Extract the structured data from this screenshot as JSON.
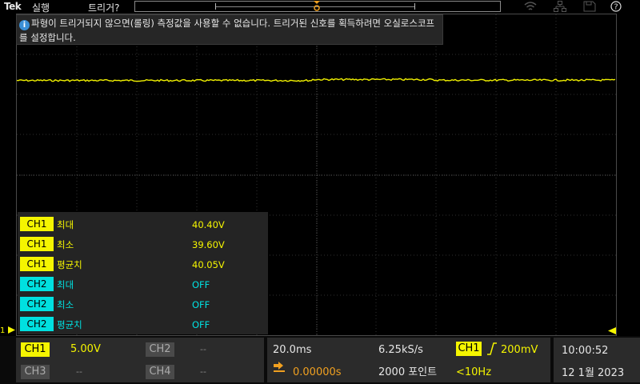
{
  "topbar": {
    "logo": "Tek",
    "run_state": "실행",
    "trigger_state": "트리거?",
    "icons": [
      "wifi-icon",
      "network-icon",
      "save-icon",
      "help-icon"
    ],
    "help_glyph": "?"
  },
  "message": {
    "icon": "info-icon",
    "icon_glyph": "i",
    "line1": "파형이 트리거되지 않으면(롤링) 측정값을 사용할 수 없습니다. 트리거된 신호를 획득하려면 오실로스코프",
    "line2": "를 설정합니다."
  },
  "measurements": [
    {
      "channel": "CH1",
      "name": "최대",
      "value": "40.40V",
      "color": "#f5f500"
    },
    {
      "channel": "CH1",
      "name": "최소",
      "value": "39.60V",
      "color": "#f5f500"
    },
    {
      "channel": "CH1",
      "name": "평균치",
      "value": "40.05V",
      "color": "#f5f500"
    },
    {
      "channel": "CH2",
      "name": "최대",
      "value": "OFF",
      "color": "#00e0e0"
    },
    {
      "channel": "CH2",
      "name": "최소",
      "value": "OFF",
      "color": "#00e0e0"
    },
    {
      "channel": "CH2",
      "name": "평균치",
      "value": "OFF",
      "color": "#00e0e0"
    }
  ],
  "markers": {
    "ch1_marker": "1"
  },
  "channels": {
    "ch1": {
      "label": "CH1",
      "scale": "5.00V"
    },
    "ch2": {
      "label": "CH2",
      "scale": "--"
    },
    "ch3": {
      "label": "CH3",
      "scale": "--"
    },
    "ch4": {
      "label": "CH4",
      "scale": "--"
    }
  },
  "horizontal": {
    "time_per_div": "20.0ms",
    "sample_rate": "6.25kS/s",
    "delay": "0.00000s",
    "record_length": "2000 포인트"
  },
  "trigger": {
    "source": "CH1",
    "level": "200mV",
    "frequency": "<10Hz"
  },
  "clock": {
    "time": "10:00:52",
    "date": "12 1월 2023"
  },
  "colors": {
    "ch1": "#f5f500",
    "ch2": "#00e0e0",
    "accent_orange": "#f0a020",
    "panel": "#2b2b2b"
  }
}
